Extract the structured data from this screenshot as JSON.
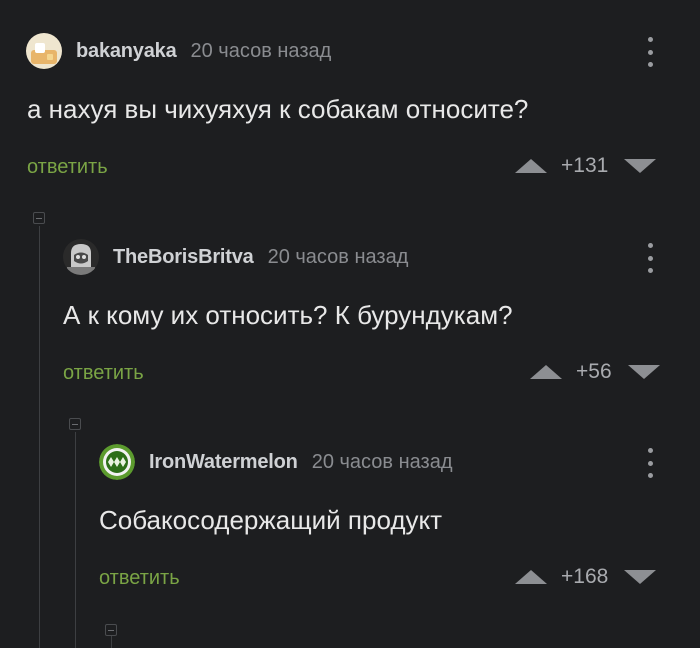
{
  "comments": [
    {
      "username": "bakanyaka",
      "time": "20 часов назад",
      "text": "а нахуя вы чихуяхуя к собакам относите?",
      "reply_label": "ответить",
      "rating": "+131"
    },
    {
      "username": "TheBorisBritva",
      "time": "20 часов назад",
      "text": "А к кому их относить? К бурундукам?",
      "reply_label": "ответить",
      "rating": "+56"
    },
    {
      "username": "IronWatermelon",
      "time": "20 часов назад",
      "text": "Собакосодержащий продукт",
      "reply_label": "ответить",
      "rating": "+168"
    }
  ],
  "colors": {
    "background": "#1d1e20",
    "reply_link": "#7aa445",
    "username": "#cfd1d4",
    "muted": "#8a8c90"
  },
  "icons": [
    "avatar",
    "more-vertical-icon",
    "arrow-up-icon",
    "arrow-down-icon",
    "collapse-icon"
  ]
}
